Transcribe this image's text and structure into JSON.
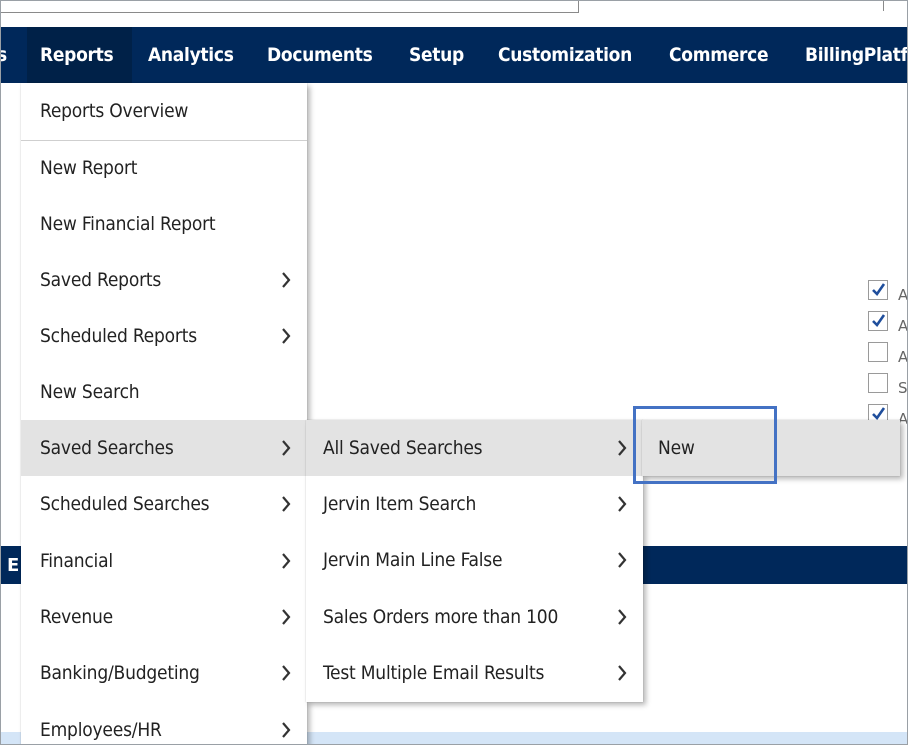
{
  "nav": {
    "items": [
      "s",
      "Reports",
      "Analytics",
      "Documents",
      "Setup",
      "Customization",
      "Commerce",
      "BillingPlatf"
    ]
  },
  "reports_menu": {
    "items": [
      {
        "label": "Reports Overview",
        "submenu": false
      },
      {
        "label": "New Report",
        "submenu": false
      },
      {
        "label": "New Financial Report",
        "submenu": false
      },
      {
        "label": "Saved Reports",
        "submenu": true
      },
      {
        "label": "Scheduled Reports",
        "submenu": true
      },
      {
        "label": "New Search",
        "submenu": false
      },
      {
        "label": "Saved Searches",
        "submenu": true
      },
      {
        "label": "Scheduled Searches",
        "submenu": true
      },
      {
        "label": "Financial",
        "submenu": true
      },
      {
        "label": "Revenue",
        "submenu": true
      },
      {
        "label": "Banking/Budgeting",
        "submenu": true
      },
      {
        "label": "Employees/HR",
        "submenu": true
      }
    ]
  },
  "saved_searches_menu": {
    "items": [
      {
        "label": "All Saved Searches"
      },
      {
        "label": "Jervin Item Search"
      },
      {
        "label": "Jervin Main Line False"
      },
      {
        "label": "Sales Orders more than 100"
      },
      {
        "label": "Test Multiple Email Results"
      }
    ]
  },
  "all_saved_searches_menu": {
    "items": [
      {
        "label": "New"
      }
    ]
  },
  "background": {
    "checkbox_letters": [
      "A",
      "A",
      "A",
      "S",
      "A"
    ],
    "band_text": "E"
  },
  "colors": {
    "nav_bg": "#00285a",
    "highlight": "#e3e3e3",
    "callout": "#4472c4"
  }
}
